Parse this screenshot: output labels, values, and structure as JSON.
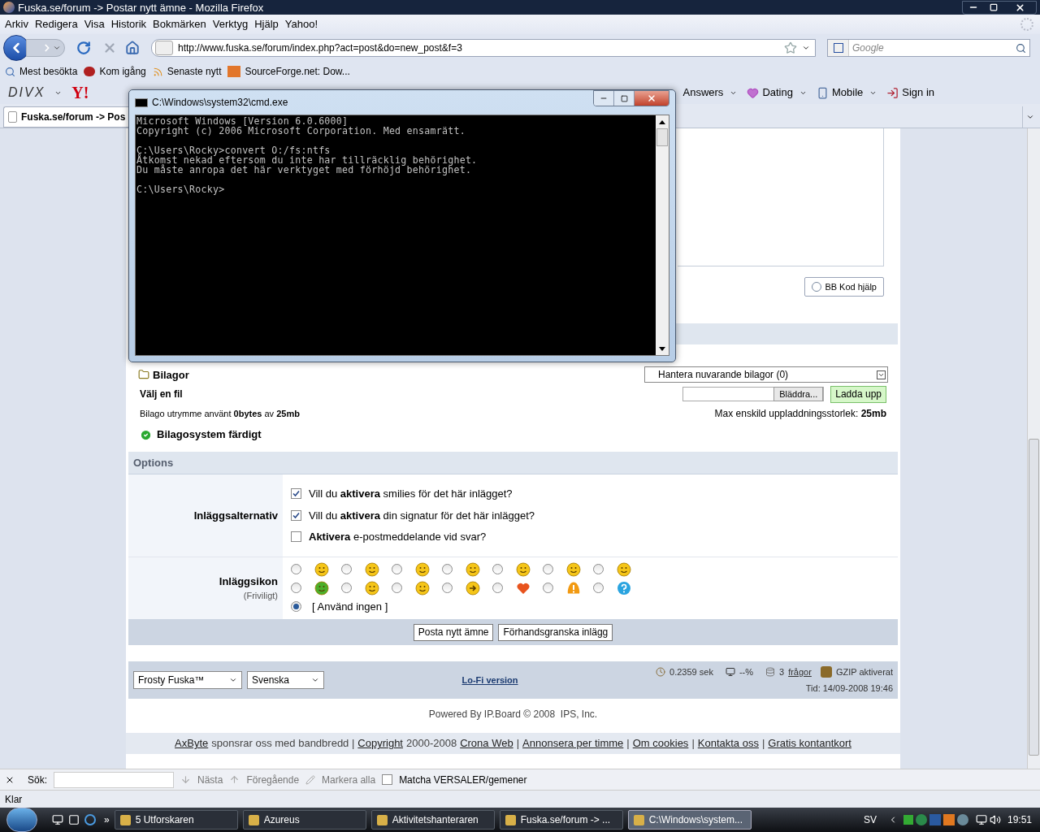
{
  "browser": {
    "title": "Fuska.se/forum -> Postar nytt ämne - Mozilla Firefox",
    "menu": [
      "Arkiv",
      "Redigera",
      "Visa",
      "Historik",
      "Bokmärken",
      "Verktyg",
      "Hjälp",
      "Yahoo!"
    ],
    "url": "http://www.fuska.se/forum/index.php?act=post&do=new_post&f=3",
    "search_placeholder": "Google",
    "bookmarks": [
      "Mest besökta",
      "Kom igång",
      "Senaste nytt",
      "SourceForge.net: Dow..."
    ],
    "toolbar_brands": [
      "DIVX",
      "Y!"
    ],
    "toolbar_items": [
      "Answers",
      "Dating",
      "Mobile",
      "Sign in"
    ],
    "tab": "Fuska.se/forum -> Pos"
  },
  "cmd": {
    "title": "C:\\Windows\\system32\\cmd.exe",
    "blocks": [
      [
        "Microsoft Windows [Version 6.0.6000]",
        "Copyright (c) 2006 Microsoft Corporation. Med ensamrätt."
      ],
      [
        "C:\\Users\\Rocky>convert O:/fs:ntfs",
        "Åtkomst nekad eftersom du inte har tillräcklig behörighet.",
        "Du måste anropa det här verktyget med förhöjd behörighet."
      ],
      [
        "C:\\Users\\Rocky>"
      ]
    ]
  },
  "page": {
    "bb_help": "BB Kod hjälp",
    "attachments": {
      "title": "Bilagor",
      "manage": "Hantera nuvarande bilagor (0)",
      "choose_label": "Välj en fil",
      "browse": "Bläddra...",
      "upload": "Ladda upp",
      "usage": "Bilago utrymme använt **0bytes** av **25mb**",
      "max": "Max enskild uppladdningsstorlek: **25mb**",
      "status": "Bilagosystem färdigt"
    },
    "options": {
      "title": "Options",
      "post_options_label": "Inläggsalternativ",
      "checkboxes": [
        {
          "text": "Vill du **aktivera** smilies för det här inlägget?",
          "checked": true
        },
        {
          "text": "Vill du **aktivera** din signatur för det här inlägget?",
          "checked": true
        },
        {
          "text": "**Aktivera** e-postmeddelande vid svar?",
          "checked": false
        }
      ],
      "icons_label": "Inläggsikon",
      "icons_hint": "(Friviligt)",
      "icons": [
        {
          "kind": "face",
          "color": "#f5c518",
          "selected": false
        },
        {
          "kind": "face",
          "color": "#f5c518",
          "selected": false
        },
        {
          "kind": "face",
          "color": "#f5c518",
          "selected": false
        },
        {
          "kind": "face",
          "color": "#f5c518",
          "selected": false
        },
        {
          "kind": "face",
          "color": "#f5c518",
          "selected": false
        },
        {
          "kind": "face",
          "color": "#f5c518",
          "selected": false
        },
        {
          "kind": "face",
          "color": "#f5c518",
          "selected": false
        },
        {
          "kind": "face",
          "color": "#4caf2a",
          "selected": false
        },
        {
          "kind": "face",
          "color": "#f5c518",
          "selected": false
        },
        {
          "kind": "face",
          "color": "#f5c518",
          "selected": false
        },
        {
          "kind": "arrow",
          "color": "#f5c518",
          "selected": false
        },
        {
          "kind": "heart",
          "color": "#e8541e",
          "selected": false
        },
        {
          "kind": "warning",
          "color": "#f29a12",
          "selected": false
        },
        {
          "kind": "question",
          "color": "#2aa4e0",
          "selected": false
        }
      ],
      "none": {
        "text": "[ Använd ingen ]",
        "selected": true
      }
    },
    "buttons": [
      "Posta nytt ämne",
      "Förhandsgranska inlägg"
    ],
    "footer": {
      "skin": "Frosty Fuska™",
      "language": "Svenska",
      "lofi": "Lo-Fi version",
      "time_taken": "0.2359 sek",
      "load": "--%",
      "queries_count": "3",
      "queries_link": "frågor",
      "gzip": "GZIP aktiverat",
      "time": "Tid: 14/09-2008 19:46",
      "powered": "Powered By IP.Board © 2008  IPS, Inc."
    },
    "sponsor": [
      {
        "kind": "link",
        "text": "AxByte"
      },
      {
        "kind": "text",
        "text": "sponsrar oss med bandbredd |"
      },
      {
        "kind": "link",
        "text": "Copyright"
      },
      {
        "kind": "text",
        "text": "2000-2008"
      },
      {
        "kind": "link",
        "text": "Crona Web"
      },
      {
        "kind": "text",
        "text": "|"
      },
      {
        "kind": "link",
        "text": "Annonsera per timme"
      },
      {
        "kind": "text",
        "text": "|"
      },
      {
        "kind": "link",
        "text": "Om cookies"
      },
      {
        "kind": "text",
        "text": "|"
      },
      {
        "kind": "link",
        "text": "Kontakta oss"
      },
      {
        "kind": "text",
        "text": "|"
      },
      {
        "kind": "link",
        "text": "Gratis kontantkort"
      }
    ]
  },
  "find_bar": {
    "label": "Sök:",
    "next": "Nästa",
    "previous": "Föregående",
    "highlight": "Markera alla",
    "match_case": {
      "text": "Matcha VERSALER/gemener",
      "checked": false
    }
  },
  "status_bar": "Klar",
  "taskbar": {
    "more": "»",
    "items": [
      {
        "label": "5 Utforskaren",
        "selected": false
      },
      {
        "label": "Azureus",
        "selected": false
      },
      {
        "label": "Aktivitetshanteraren",
        "selected": false
      },
      {
        "label": "Fuska.se/forum -> ...",
        "selected": false
      },
      {
        "label": "C:\\Windows\\system...",
        "selected": true
      }
    ],
    "language": "SV",
    "clock": "19:51"
  }
}
